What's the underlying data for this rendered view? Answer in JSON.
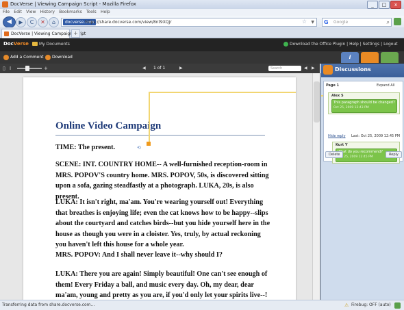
{
  "window": {
    "title": "DocVerse | Viewing Campaign Script - Mozilla Firefox",
    "controls": [
      "_",
      "□",
      "x"
    ]
  },
  "menu": [
    "File",
    "Edit",
    "View",
    "History",
    "Bookmarks",
    "Tools",
    "Help"
  ],
  "nav": {
    "site_label": "docverse.com",
    "url": "https://share.docverse.com/view/8nt9XQjr",
    "search_placeholder": "Google",
    "back": "◀",
    "forward": "▶",
    "reload": "C",
    "stop": "✕",
    "home": "⌂"
  },
  "tabs": [
    {
      "label": "DocVerse | Viewing Campaign Script"
    }
  ],
  "new_tab": "+",
  "app": {
    "logo_doc": "Doc",
    "logo_verse": "Verse",
    "my_documents": "My Documents",
    "header_links": "Download the Office Plugin  |  Help  |  Settings  |  Logout"
  },
  "toolbar": {
    "add_comment": "Add a Comment",
    "download": "Download"
  },
  "panel_tabs": {
    "info": "i",
    "comments": "",
    "rss": ""
  },
  "viewer": {
    "page_indicator": "1 of 1",
    "search_placeholder": "Search",
    "prev": "◀",
    "next": "▶",
    "prev2": "◀",
    "next2": "▶"
  },
  "document": {
    "title": "Online Video Campaign",
    "paragraphs": [
      "TIME: The present.",
      "SCENE: INT. COUNTRY HOME-- A well-furnished reception-room in MRS. POPOV'S country home. MRS. POPOV, 50s, is discovered sitting upon a sofa, gazing steadfastly at a photograph. LUKA, 20s, is also present.",
      "LUKA: It isn't right, ma'am. You're wearing yourself out! Everything that breathes is enjoying life; even the cat knows how to be happy--slips about the courtyard and catches birds--but you hide yourself here in the house as though you were in a cloister. Yes, truly, by actual reckoning you haven't left this house for a whole year.",
      "MRS. POPOV: And I shall never leave it--why should I?",
      "LUKA: There you are again! Simply beautiful! One can't see enough of them! Every Friday a ball, and music every day. Oh, my dear, dear ma'am, young and pretty as you are, if you'd only let your spirits live--! Beauty can't last forever. When ten short years are over, you'll be glad enough to go out a bit"
    ]
  },
  "discussions": {
    "title": "Discussions",
    "page_label": "Page 1",
    "expand_all": "Expand All",
    "comments": [
      {
        "author": "Alex S",
        "text": "This paragraph should be changed?",
        "date": "Oct 25, 2009 12:43 PM"
      },
      {
        "author": "Kurt Y",
        "text": "What do you recommend?",
        "date": "Oct 25, 2009 12:45 PM"
      }
    ],
    "hide_reply": "Hide reply",
    "last_reply": "Last: Oct 25, 2009 12:45 PM",
    "delete_label": "Delete",
    "reply_label": "Reply"
  },
  "status": {
    "text": "Transferring data from share.docverse.com...",
    "addon": "Firebug: OFF (auto)"
  },
  "colors": {
    "accent_orange": "#f09a1c",
    "doc_title_blue": "#1e3a78",
    "panel_blue": "#3a5f9a",
    "comment_green": "#7cc44a"
  }
}
